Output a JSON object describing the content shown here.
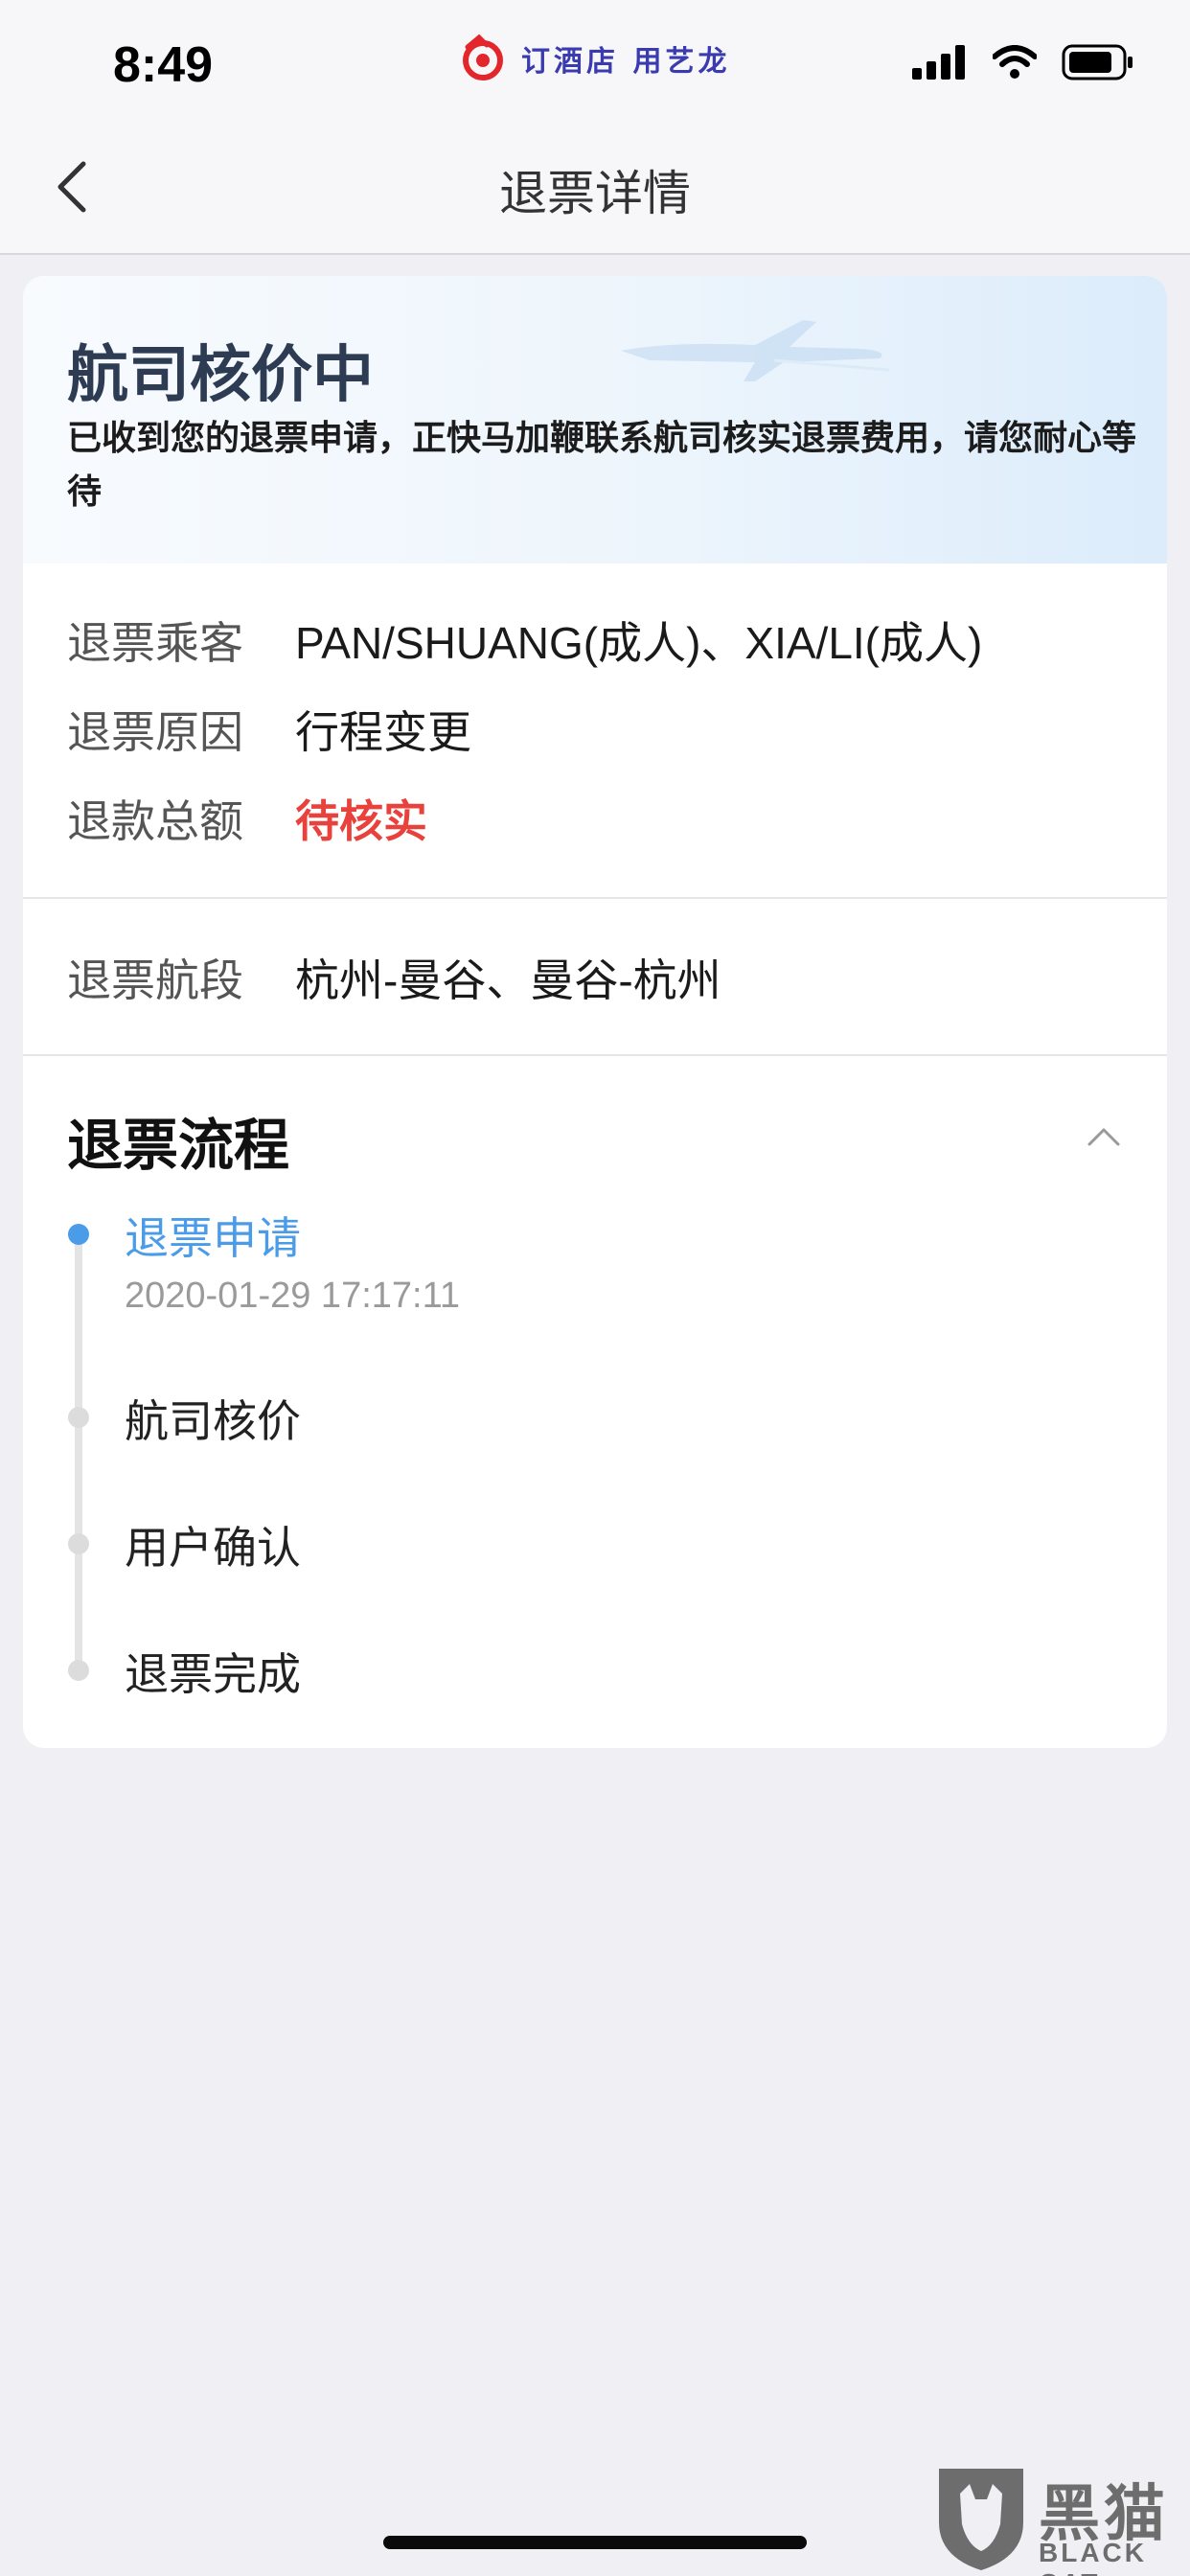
{
  "status_bar": {
    "time": "8:49",
    "ad_text": "订酒店 用艺龙"
  },
  "nav": {
    "title": "退票详情"
  },
  "hero": {
    "title": "航司核价中",
    "description": "已收到您的退票申请，正快马加鞭联系航司核实退票费用，请您耐心等待"
  },
  "info": {
    "passengers_label": "退票乘客",
    "passengers_value": "PAN/SHUANG(成人)、XIA/LI(成人)",
    "reason_label": "退票原因",
    "reason_value": "行程变更",
    "amount_label": "退款总额",
    "amount_value": "待核实",
    "segment_label": "退票航段",
    "segment_value": "杭州-曼谷、曼谷-杭州"
  },
  "process": {
    "title": "退票流程",
    "steps": [
      {
        "label": "退票申请",
        "time": "2020-01-29 17:17:11",
        "active": true
      },
      {
        "label": "航司核价",
        "active": false
      },
      {
        "label": "用户确认",
        "active": false
      },
      {
        "label": "退票完成",
        "active": false
      }
    ]
  },
  "watermark": {
    "cn": "黑猫",
    "en": "BLACK CAT"
  },
  "colors": {
    "accent_blue": "#4a9be8",
    "pending_red": "#e9413c",
    "hero_title": "#2d3b53",
    "background": "#efeff4"
  }
}
